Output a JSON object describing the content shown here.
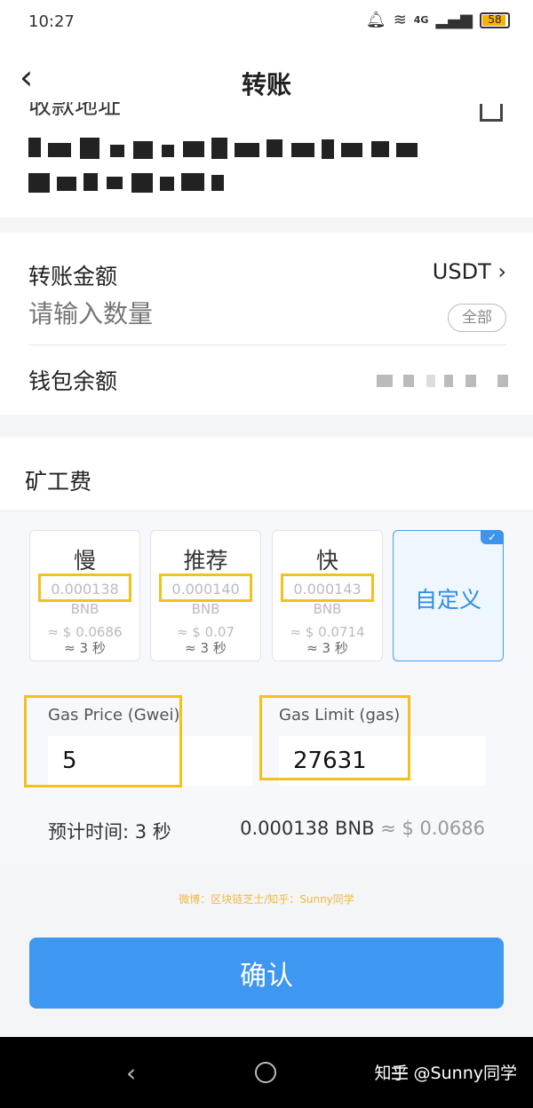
{
  "status_bar": {
    "time": "10:27",
    "network": "4G",
    "battery": "58"
  },
  "header": {
    "title": "转账",
    "back_icon": "chevron-left-icon"
  },
  "address_section": {
    "label": "收款地址",
    "address_redacted": true
  },
  "amount_section": {
    "label": "转账金额",
    "token": "USDT",
    "placeholder": "请输入数量",
    "all_button": "全部",
    "balance_label": "钱包余额"
  },
  "fee_section": {
    "title": "矿工费",
    "options": [
      {
        "name": "慢",
        "bnb": "0.000138",
        "unit": "BNB",
        "usd": "≈ $ 0.0686",
        "time": "≈ 3 秒"
      },
      {
        "name": "推荐",
        "bnb": "0.000140",
        "unit": "BNB",
        "usd": "≈ $ 0.07",
        "time": "≈ 3 秒"
      },
      {
        "name": "快",
        "bnb": "0.000143",
        "unit": "BNB",
        "usd": "≈ $ 0.0714",
        "time": "≈ 3 秒"
      }
    ],
    "custom_label": "自定义",
    "custom_selected": true,
    "gas_price": {
      "label": "Gas Price (Gwei)",
      "value": "5"
    },
    "gas_limit": {
      "label": "Gas Limit (gas)",
      "value": "27631"
    },
    "estimate_label": "预计时间: 3 秒",
    "estimate_bnb": "0.000138 BNB",
    "estimate_usd": "≈ $ 0.0686"
  },
  "watermark": "微博：区块链芝士/知乎：Sunny同学",
  "confirm_button": "确认",
  "footer_credit": "知乎 @Sunny同学",
  "colors": {
    "primary": "#3e97f0",
    "highlight": "#f3c11b",
    "custom_bg": "#eef6fe"
  }
}
